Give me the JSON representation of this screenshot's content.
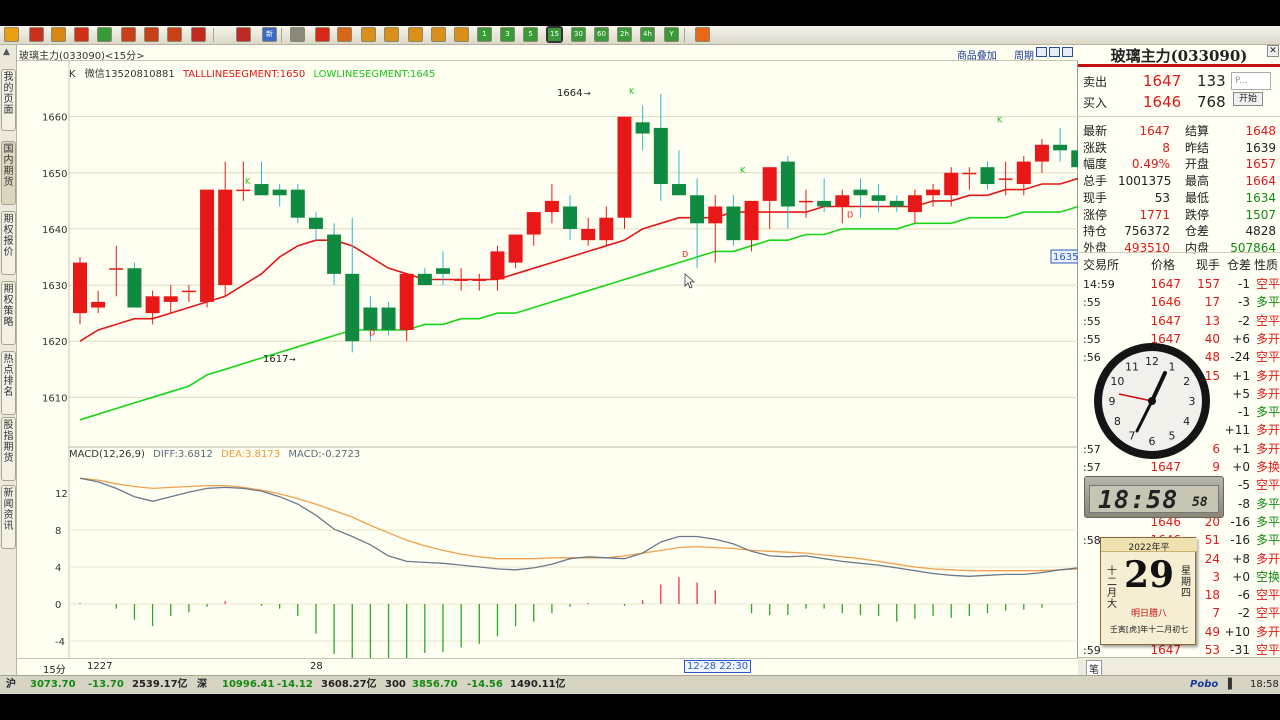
{
  "toolbar": {
    "icons": [
      "back-arrow-icon",
      "home-icon",
      "book-icon",
      "folder-icon",
      "refresh-icon",
      "zoom-in-icon",
      "zoom-out-icon",
      "windows-icon",
      "pen-icon",
      "filter-icon",
      "new-icon",
      "grid-icon",
      "line-chart-icon",
      "minute-icon",
      "day-icon",
      "week-icon",
      "month-icon",
      "season-icon",
      "year-icon",
      "1min-icon",
      "5min-icon",
      "15min-icon",
      "15min-active-icon",
      "30min-icon",
      "60min-icon",
      "2h-icon",
      "4h-icon",
      "y-icon",
      "book2-icon"
    ],
    "labels": {
      "icon10": "新",
      "icon19": "1",
      "icon20": "3",
      "icon21": "5",
      "icon22": "15",
      "icon23": "30",
      "icon24": "60",
      "icon25": "2h",
      "icon26": "4h",
      "icon27": "Y"
    }
  },
  "left_tabs": [
    "我的页面",
    "国内期货",
    "期权报价",
    "期权策略",
    "热点排名",
    "股指期货",
    "新闻资讯"
  ],
  "chart": {
    "title": "玻璃主力(033090)<15分>",
    "links": [
      "商品叠加",
      "周期"
    ],
    "legend_main": {
      "k": "K",
      "wechat": "微信13520810881",
      "tall": "TALLLINESEGMENT:1650",
      "low": "LOWLINESEGMENT:1645"
    },
    "legend_macd": {
      "name": "MACD(12,26,9)",
      "diff": "DIFF:3.6812",
      "dea": "DEA:3.8173",
      "macd": "MACD:-0.2723"
    },
    "price_ticks": [
      "1660",
      "1650",
      "1640",
      "1630",
      "1620",
      "1610"
    ],
    "macd_ticks": [
      "12",
      "8",
      "4",
      "0",
      "-4"
    ],
    "annotations": {
      "high": "1664",
      "low": "1617",
      "current_price": "1635",
      "k": "K",
      "d": "D"
    },
    "period": "15分",
    "xlabels": [
      "1227",
      "28"
    ],
    "cursor_label": "12-28 22:30"
  },
  "chart_data": {
    "type": "candlestick",
    "title": "玻璃主力(033090)<15分>",
    "ylim": [
      1604,
      1666
    ],
    "candles": [
      {
        "o": 1625,
        "h": 1635,
        "l": 1623,
        "c": 1634
      },
      {
        "o": 1626,
        "h": 1629,
        "l": 1625,
        "c": 1627
      },
      {
        "o": 1633,
        "h": 1637,
        "l": 1628,
        "c": 1633
      },
      {
        "o": 1633,
        "h": 1634,
        "l": 1626,
        "c": 1626
      },
      {
        "o": 1625,
        "h": 1629,
        "l": 1623,
        "c": 1628
      },
      {
        "o": 1627,
        "h": 1630,
        "l": 1625,
        "c": 1628
      },
      {
        "o": 1629,
        "h": 1630,
        "l": 1627,
        "c": 1629
      },
      {
        "o": 1627,
        "h": 1635,
        "l": 1626,
        "c": 1647
      },
      {
        "o": 1630,
        "h": 1652,
        "l": 1628,
        "c": 1647
      },
      {
        "o": 1647,
        "h": 1652,
        "l": 1645,
        "c": 1647
      },
      {
        "o": 1648,
        "h": 1652,
        "l": 1647,
        "c": 1646
      },
      {
        "o": 1647,
        "h": 1648,
        "l": 1644,
        "c": 1646
      },
      {
        "o": 1647,
        "h": 1648,
        "l": 1641,
        "c": 1642
      },
      {
        "o": 1642,
        "h": 1643,
        "l": 1638,
        "c": 1640
      },
      {
        "o": 1639,
        "h": 1641,
        "l": 1630,
        "c": 1632
      },
      {
        "o": 1632,
        "h": 1642,
        "l": 1618,
        "c": 1620
      },
      {
        "o": 1626,
        "h": 1628,
        "l": 1620,
        "c": 1622
      },
      {
        "o": 1626,
        "h": 1627,
        "l": 1621,
        "c": 1622
      },
      {
        "o": 1622,
        "h": 1625,
        "l": 1620,
        "c": 1632
      },
      {
        "o": 1632,
        "h": 1633,
        "l": 1630,
        "c": 1630
      },
      {
        "o": 1633,
        "h": 1636,
        "l": 1630,
        "c": 1632
      },
      {
        "o": 1631,
        "h": 1633,
        "l": 1629,
        "c": 1631
      },
      {
        "o": 1631,
        "h": 1632,
        "l": 1629,
        "c": 1631
      },
      {
        "o": 1631,
        "h": 1637,
        "l": 1629,
        "c": 1636
      },
      {
        "o": 1634,
        "h": 1639,
        "l": 1633,
        "c": 1639
      },
      {
        "o": 1639,
        "h": 1643,
        "l": 1637,
        "c": 1643
      },
      {
        "o": 1643,
        "h": 1648,
        "l": 1641,
        "c": 1645
      },
      {
        "o": 1644,
        "h": 1646,
        "l": 1638,
        "c": 1640
      },
      {
        "o": 1638,
        "h": 1642,
        "l": 1637,
        "c": 1640
      },
      {
        "o": 1638,
        "h": 1644,
        "l": 1637,
        "c": 1642
      },
      {
        "o": 1642,
        "h": 1660,
        "l": 1640,
        "c": 1660
      },
      {
        "o": 1659,
        "h": 1662,
        "l": 1654,
        "c": 1657
      },
      {
        "o": 1658,
        "h": 1664,
        "l": 1645,
        "c": 1648
      },
      {
        "o": 1648,
        "h": 1654,
        "l": 1647,
        "c": 1646
      },
      {
        "o": 1646,
        "h": 1649,
        "l": 1633,
        "c": 1641
      },
      {
        "o": 1641,
        "h": 1646,
        "l": 1634,
        "c": 1644
      },
      {
        "o": 1644,
        "h": 1646,
        "l": 1637,
        "c": 1638
      },
      {
        "o": 1638,
        "h": 1645,
        "l": 1636,
        "c": 1645
      },
      {
        "o": 1645,
        "h": 1651,
        "l": 1640,
        "c": 1651
      },
      {
        "o": 1652,
        "h": 1653,
        "l": 1640,
        "c": 1644
      },
      {
        "o": 1645,
        "h": 1647,
        "l": 1642,
        "c": 1645
      },
      {
        "o": 1645,
        "h": 1649,
        "l": 1643,
        "c": 1644
      },
      {
        "o": 1644,
        "h": 1647,
        "l": 1641,
        "c": 1646
      },
      {
        "o": 1647,
        "h": 1649,
        "l": 1642,
        "c": 1646
      },
      {
        "o": 1646,
        "h": 1648,
        "l": 1643,
        "c": 1645
      },
      {
        "o": 1645,
        "h": 1646,
        "l": 1643,
        "c": 1644
      },
      {
        "o": 1643,
        "h": 1647,
        "l": 1641,
        "c": 1646
      },
      {
        "o": 1646,
        "h": 1648,
        "l": 1644,
        "c": 1647
      },
      {
        "o": 1646,
        "h": 1651,
        "l": 1644,
        "c": 1650
      },
      {
        "o": 1650,
        "h": 1651,
        "l": 1647,
        "c": 1650
      },
      {
        "o": 1651,
        "h": 1652,
        "l": 1647,
        "c": 1648
      },
      {
        "o": 1649,
        "h": 1652,
        "l": 1646,
        "c": 1649
      },
      {
        "o": 1648,
        "h": 1653,
        "l": 1646,
        "c": 1652
      },
      {
        "o": 1652,
        "h": 1656,
        "l": 1650,
        "c": 1655
      },
      {
        "o": 1655,
        "h": 1658,
        "l": 1652,
        "c": 1654
      },
      {
        "o": 1654,
        "h": 1656,
        "l": 1652,
        "c": 1651
      },
      {
        "o": 1651,
        "h": 1659,
        "l": 1650,
        "c": 1659
      },
      {
        "o": 1652,
        "h": 1658,
        "l": 1650,
        "c": 1656
      },
      {
        "o": 1655,
        "h": 1656,
        "l": 1647,
        "c": 1649
      },
      {
        "o": 1649,
        "h": 1656,
        "l": 1646,
        "c": 1654
      }
    ],
    "series": [
      {
        "values": [
          1620,
          1622,
          1623,
          1624,
          1624,
          1625,
          1626,
          1627,
          1628,
          1630,
          1632,
          1635,
          1637,
          1638,
          1638,
          1637,
          1635,
          1633,
          1632,
          1631,
          1631,
          1631,
          1631,
          1631,
          1632,
          1633,
          1634,
          1635,
          1636,
          1637,
          1638,
          1640,
          1641,
          1642,
          1642,
          1642,
          1643,
          1643,
          1643,
          1643,
          1643,
          1644,
          1644,
          1644,
          1644,
          1644,
          1644,
          1645,
          1645,
          1646,
          1646,
          1647,
          1647,
          1648,
          1648,
          1649,
          1650,
          1650,
          1650,
          1650
        ]
      },
      {
        "values": [
          1606,
          1607,
          1608,
          1609,
          1610,
          1611,
          1612,
          1614,
          1615,
          1616,
          1617,
          1618,
          1619,
          1620,
          1621,
          1622,
          1622,
          1622,
          1622,
          1623,
          1623,
          1624,
          1624,
          1625,
          1625,
          1626,
          1627,
          1628,
          1629,
          1630,
          1631,
          1632,
          1633,
          1634,
          1635,
          1636,
          1636,
          1637,
          1638,
          1638,
          1639,
          1639,
          1640,
          1640,
          1640,
          1640,
          1641,
          1641,
          1641,
          1642,
          1642,
          1642,
          1643,
          1643,
          1643,
          1644,
          1644,
          1645,
          1645,
          1645
        ]
      }
    ],
    "macd": {
      "ylim": [
        -7.3,
        14
      ],
      "diff": [
        13.6,
        13.2,
        12.5,
        11.6,
        11.1,
        11.6,
        12.1,
        12.5,
        12.6,
        12.5,
        12.2,
        11.6,
        10.8,
        9.6,
        8.1,
        7.3,
        6.4,
        5.2,
        4.6,
        4.5,
        4.4,
        4.2,
        4.0,
        3.8,
        3.7,
        3.9,
        4.3,
        4.9,
        5.1,
        5.0,
        4.9,
        5.5,
        6.7,
        7.3,
        7.3,
        7.0,
        6.5,
        5.7,
        5.2,
        5.1,
        5.2,
        4.9,
        4.6,
        4.4,
        4.2,
        3.9,
        3.6,
        3.3,
        3.1,
        3.0,
        3.1,
        3.2,
        3.2,
        3.4,
        3.7,
        3.9,
        4.1,
        4.2,
        4.2,
        3.7
      ],
      "dea": [
        13.6,
        13.4,
        13.0,
        12.7,
        12.5,
        12.6,
        12.7,
        12.8,
        12.8,
        12.6,
        12.3,
        11.9,
        11.4,
        10.8,
        10.1,
        9.4,
        8.5,
        7.7,
        6.9,
        6.3,
        5.8,
        5.4,
        5.1,
        4.9,
        4.9,
        4.9,
        5.0,
        5.0,
        5.0,
        5.0,
        5.2,
        5.5,
        5.8,
        6.1,
        6.2,
        6.1,
        6.0,
        5.8,
        5.7,
        5.6,
        5.5,
        5.3,
        5.1,
        4.9,
        4.6,
        4.3,
        4.0,
        3.8,
        3.7,
        3.6,
        3.6,
        3.6,
        3.6,
        3.6,
        3.7,
        3.8,
        3.9,
        4.0,
        4.0,
        3.8
      ],
      "hist": [
        0.1,
        0.0,
        -0.5,
        -1.7,
        -2.4,
        -1.3,
        -0.9,
        -0.3,
        0.3,
        0.0,
        -0.2,
        -0.5,
        -1.3,
        -3.2,
        -5.4,
        -5.9,
        -6.6,
        -6.7,
        -6.1,
        -5.3,
        -5.2,
        -4.7,
        -4.3,
        -3.5,
        -2.4,
        -1.9,
        -1.0,
        -0.3,
        0.1,
        0.0,
        -0.2,
        0.4,
        2.1,
        2.9,
        2.3,
        1.5,
        0.0,
        -1.0,
        -1.2,
        -1.2,
        -0.5,
        -0.5,
        -1.0,
        -1.2,
        -1.3,
        -1.9,
        -1.6,
        -1.3,
        -1.5,
        -1.3,
        -1.0,
        -0.7,
        -0.6,
        -0.4,
        0.0,
        0.3,
        0.8,
        0.9,
        0.8,
        -0.3
      ]
    }
  },
  "quote": {
    "title": "玻璃主力(033090)",
    "sell_label": "卖出",
    "sell_price": "1647",
    "sell_vol": "133",
    "buy_label": "买入",
    "buy_price": "1646",
    "buy_vol": "768",
    "input_placeholder": "P...",
    "start_button": "开始",
    "stats": [
      {
        "l1": "最新",
        "v1": "1647",
        "c1": "red",
        "l2": "结算",
        "v2": "1648",
        "c2": "red"
      },
      {
        "l1": "涨跌",
        "v1": "8",
        "c1": "red",
        "l2": "昨结",
        "v2": "1639",
        "c2": "blk"
      },
      {
        "l1": "幅度",
        "v1": "0.49%",
        "c1": "red",
        "l2": "开盘",
        "v2": "1657",
        "c2": "red"
      },
      {
        "l1": "总手",
        "v1": "1001375",
        "c1": "blk",
        "l2": "最高",
        "v2": "1664",
        "c2": "red"
      },
      {
        "l1": "现手",
        "v1": "53",
        "c1": "blk",
        "l2": "最低",
        "v2": "1634",
        "c2": "grn"
      },
      {
        "l1": "涨停",
        "v1": "1771",
        "c1": "red",
        "l2": "跌停",
        "v2": "1507",
        "c2": "grn"
      },
      {
        "l1": "持仓",
        "v1": "756372",
        "c1": "blk",
        "l2": "仓差",
        "v2": "4828",
        "c2": "blk"
      },
      {
        "l1": "外盘",
        "v1": "493510",
        "c1": "red",
        "l2": "内盘",
        "v2": "507864",
        "c2": "grn"
      }
    ],
    "tick_headers": [
      "交易所",
      "价格",
      "现手",
      "仓差",
      "性质"
    ],
    "ticks": [
      {
        "t": "14:59",
        "p": "1647",
        "v": "157",
        "d": "-1",
        "n": "空平",
        "nc": "red"
      },
      {
        "t": ":55",
        "p": "1646",
        "v": "17",
        "d": "-3",
        "n": "多平",
        "nc": "grn"
      },
      {
        "t": ":55",
        "p": "1647",
        "v": "13",
        "d": "-2",
        "n": "空平",
        "nc": "red"
      },
      {
        "t": ":55",
        "p": "1647",
        "v": "40",
        "d": "+6",
        "n": "多开",
        "nc": "red"
      },
      {
        "t": ":56",
        "p": "1647",
        "v": "48",
        "d": "-24",
        "n": "空平",
        "nc": "red"
      },
      {
        "t": "",
        "p": "",
        "v": "15",
        "d": "+1",
        "n": "多开",
        "nc": "red"
      },
      {
        "t": "",
        "p": "",
        "v": "",
        "d": "+5",
        "n": "多开",
        "nc": "red"
      },
      {
        "t": "",
        "p": "",
        "v": "",
        "d": "-1",
        "n": "多平",
        "nc": "grn"
      },
      {
        "t": "",
        "p": "",
        "v": "",
        "d": "+11",
        "n": "多开",
        "nc": "red"
      },
      {
        "t": ":57",
        "p": "",
        "v": "6",
        "d": "+1",
        "n": "多开",
        "nc": "red"
      },
      {
        "t": ":57",
        "p": "1647",
        "v": "9",
        "d": "+0",
        "n": "多换",
        "nc": "red"
      },
      {
        "t": ":57",
        "p": "1647",
        "v": "50",
        "d": "-5",
        "n": "空平",
        "nc": "red"
      },
      {
        "t": "",
        "p": "",
        "v": "",
        "d": "-8",
        "n": "多平",
        "nc": "grn"
      },
      {
        "t": "",
        "p": "1646",
        "v": "20",
        "d": "-16",
        "n": "多平",
        "nc": "grn"
      },
      {
        "t": ":58",
        "p": "1646",
        "v": "51",
        "d": "-16",
        "n": "多平",
        "nc": "grn"
      },
      {
        "t": "",
        "p": "",
        "v": "24",
        "d": "+8",
        "n": "多开",
        "nc": "red"
      },
      {
        "t": "",
        "p": "",
        "v": "3",
        "d": "+0",
        "n": "空换",
        "nc": "grn"
      },
      {
        "t": "",
        "p": "",
        "v": "18",
        "d": "-6",
        "n": "空平",
        "nc": "red"
      },
      {
        "t": "",
        "p": "",
        "v": "7",
        "d": "-2",
        "n": "空平",
        "nc": "red"
      },
      {
        "t": "",
        "p": "",
        "v": "49",
        "d": "+10",
        "n": "多开",
        "nc": "red"
      },
      {
        "t": ":59",
        "p": "1647",
        "v": "53",
        "d": "-31",
        "n": "空平",
        "nc": "red"
      }
    ],
    "bottom_tab": "笔"
  },
  "widgets": {
    "digital_time": "18:58",
    "digital_suffix": "58",
    "calendar": {
      "year": "2022年平",
      "day": "29",
      "month": "十二月大",
      "weekday": "星期四",
      "festival": "明日腊八",
      "lunar": "壬寅[虎]年十二月初七"
    }
  },
  "status": {
    "items": [
      {
        "label": "沪",
        "index": "3073.70",
        "change": "-13.70",
        "amount": "2539.17亿"
      },
      {
        "label": "深",
        "index": "10996.41",
        "change": "-14.12",
        "amount": "3608.27亿"
      },
      {
        "label": "300",
        "index": "3856.70",
        "change": "-14.56",
        "amount": "1490.11亿"
      }
    ],
    "brand": "Pobo",
    "time": "18:58"
  }
}
